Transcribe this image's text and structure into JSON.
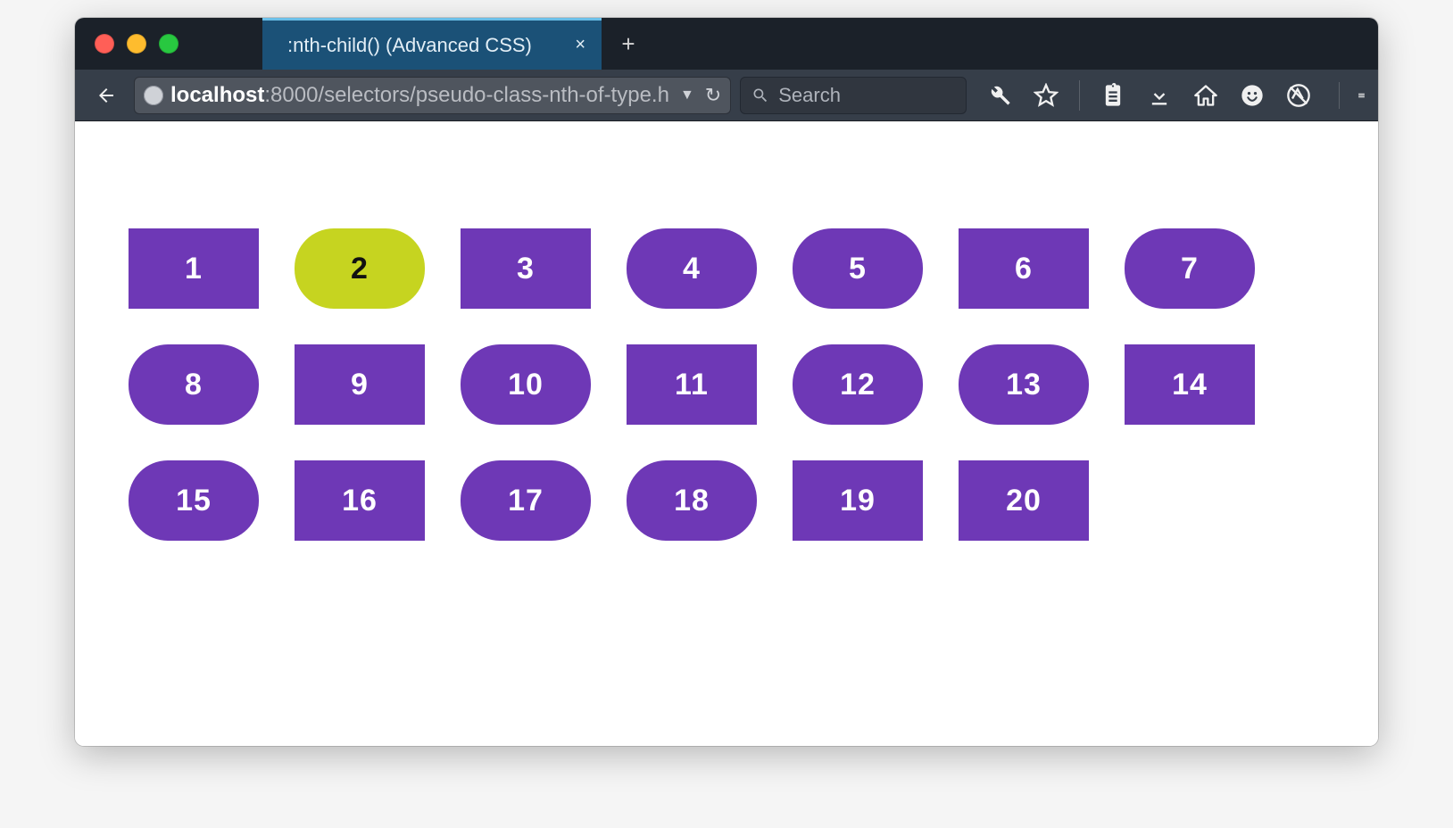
{
  "window": {
    "tab_title": ":nth-child() (Advanced CSS)",
    "new_tab_glyph": "+",
    "tab_close_glyph": "×"
  },
  "address": {
    "host": "localhost",
    "rest": ":8000/selectors/pseudo-class-nth-of-type.h",
    "dropdown_glyph": "▼",
    "reload_glyph": "↻"
  },
  "search": {
    "placeholder": "Search"
  },
  "tiles": [
    {
      "label": "1",
      "shape": "square",
      "active": false
    },
    {
      "label": "2",
      "shape": "rounded",
      "active": true
    },
    {
      "label": "3",
      "shape": "square",
      "active": false
    },
    {
      "label": "4",
      "shape": "rounded",
      "active": false
    },
    {
      "label": "5",
      "shape": "rounded",
      "active": false
    },
    {
      "label": "6",
      "shape": "square",
      "active": false
    },
    {
      "label": "7",
      "shape": "rounded",
      "active": false
    },
    {
      "label": "8",
      "shape": "rounded",
      "active": false
    },
    {
      "label": "9",
      "shape": "square",
      "active": false
    },
    {
      "label": "10",
      "shape": "rounded",
      "active": false
    },
    {
      "label": "11",
      "shape": "square",
      "active": false
    },
    {
      "label": "12",
      "shape": "rounded",
      "active": false
    },
    {
      "label": "13",
      "shape": "rounded",
      "active": false
    },
    {
      "label": "14",
      "shape": "square",
      "active": false
    },
    {
      "label": "15",
      "shape": "rounded",
      "active": false
    },
    {
      "label": "16",
      "shape": "square",
      "active": false
    },
    {
      "label": "17",
      "shape": "rounded",
      "active": false
    },
    {
      "label": "18",
      "shape": "rounded",
      "active": false
    },
    {
      "label": "19",
      "shape": "square",
      "active": false
    },
    {
      "label": "20",
      "shape": "square",
      "active": false
    }
  ]
}
